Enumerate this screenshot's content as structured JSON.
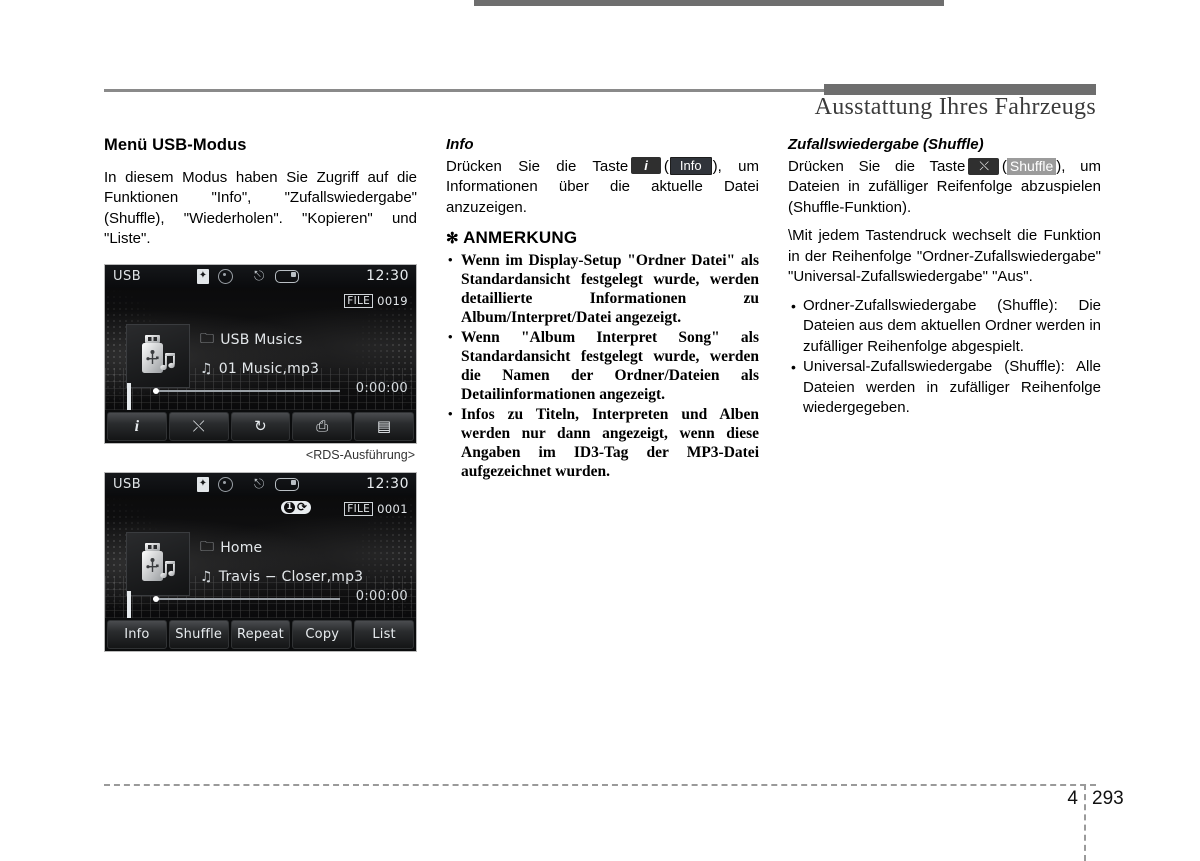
{
  "header": {
    "title": "Ausstattung Ihres Fahrzeugs"
  },
  "footer": {
    "chapter": "4",
    "page": "293"
  },
  "col1": {
    "heading": "Menü USB-Modus",
    "paragraph": "In diesem Modus haben Sie Zugriff auf die Funktionen \"Info\", \"Zufallswiedergabe\" (Shuffle), \"Wiederholen\". \"Kopieren\" und \"Liste\".",
    "caption": "<RDS-Ausführung>"
  },
  "device1": {
    "source": "USB",
    "clock": "12:30",
    "file_label": "FILE",
    "file_number": "0019",
    "folder": "USB Musics",
    "track": "01 Music,mp3",
    "time": "0:00:00",
    "buttons": [
      {
        "name": "info-button",
        "icon": "info-icon",
        "glyph": "i"
      },
      {
        "name": "shuffle-button",
        "icon": "shuffle-icon",
        "glyph": "⤬"
      },
      {
        "name": "repeat-button",
        "icon": "repeat-icon",
        "glyph": "↻"
      },
      {
        "name": "copy-button",
        "icon": "copy-icon",
        "glyph": "⎙"
      },
      {
        "name": "list-button",
        "icon": "list-icon",
        "glyph": "▤"
      }
    ],
    "status_icons": [
      "bluetooth-icon",
      "disc-icon",
      "usb-icon",
      "battery-icon"
    ]
  },
  "device2": {
    "source": "USB",
    "clock": "12:30",
    "file_label": "FILE",
    "file_number": "0001",
    "repeat_badge": "1",
    "folder": "Home",
    "track": "Travis − Closer,mp3",
    "time": "0:00:00",
    "buttons": [
      {
        "name": "info-button",
        "label": "Info"
      },
      {
        "name": "shuffle-button",
        "label": "Shuffle"
      },
      {
        "name": "repeat-button",
        "label": "Repeat"
      },
      {
        "name": "copy-button",
        "label": "Copy"
      },
      {
        "name": "list-button",
        "label": "List"
      }
    ],
    "status_icons": [
      "bluetooth-icon",
      "disc-icon",
      "usb-icon",
      "battery-icon"
    ]
  },
  "col2": {
    "subheading": "Info",
    "line_a": "Drücken Sie die Taste",
    "chip_icon": "i",
    "paren_open": "(",
    "chip_label": "Info",
    "paren_close": "),",
    "line_b": "um Informationen über die aktuelle Datei anzuzeigen.",
    "note_star": "✻",
    "note_title": "ANMERKUNG",
    "notes": [
      "Wenn im Display-Setup \"Ordner Datei\" als Standardansicht festgelegt wurde, werden detaillierte Informationen zu Album/Interpret/Datei angezeigt.",
      "Wenn \"Album Interpret Song\" als Standardansicht festgelegt wurde, werden die Namen der Ordner/Dateien als Detailinformationen angezeigt.",
      "Infos zu Titeln, Interpreten und Alben werden nur dann angezeigt, wenn diese Angaben im ID3-Tag der MP3-Datei aufgezeichnet wurden."
    ]
  },
  "col3": {
    "subheading": "Zufallswiedergabe (Shuffle)",
    "line_a": "Drücken Sie die Taste",
    "chip_icon": "⤬",
    "paren_open": "(",
    "chip_label": "Shuffle",
    "paren_close": "),",
    "line_b": "um Dateien in zufälliger Reifenfolge abzuspielen (Shuffle-Funktion).",
    "line_c": "\\Mit jedem Tastendruck wechselt die Funktion in der Reihenfolge \"Ordner-Zufallswiedergabe\"  \"Universal-Zufallswiedergabe\"  \"Aus\".",
    "bullets": [
      "Ordner-Zufallswiedergabe (Shuffle): Die Dateien aus dem aktuellen Ordner werden in zufälliger Reihenfolge abgespielt.",
      "Universal-Zufallswiedergabe (Shuffle): Alle Dateien werden in zufälliger Reihenfolge wiedergegeben."
    ]
  }
}
